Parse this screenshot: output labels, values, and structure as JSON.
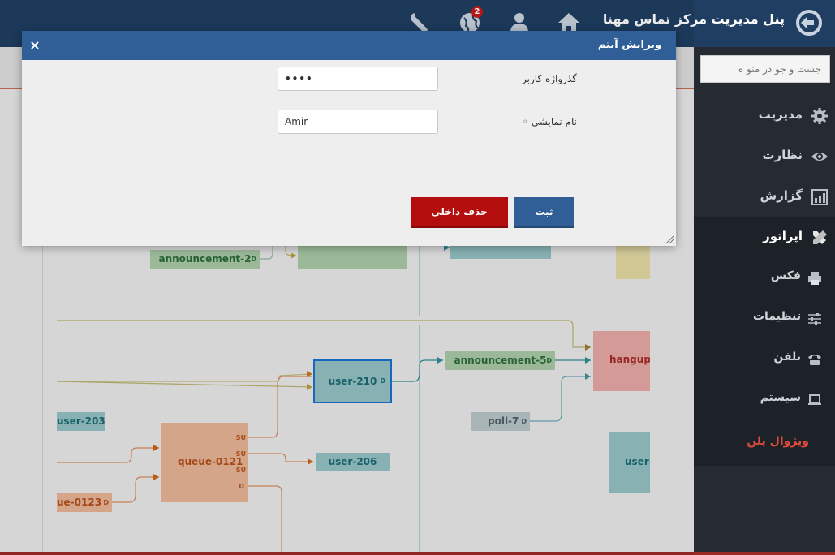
{
  "header": {
    "app_title": "پنل مدیریت مرکز تماس مهنا",
    "notification_count": "2"
  },
  "sidebar": {
    "search_placeholder": "جست و جو در منو ه",
    "items": [
      {
        "label": "مدیریت",
        "icon": "gear-icon"
      },
      {
        "label": "نظارت",
        "icon": "eye-icon"
      },
      {
        "label": "گزارش",
        "icon": "chart-icon"
      },
      {
        "label": "اپراتور",
        "icon": "tools-icon"
      },
      {
        "label": "فکس",
        "icon": "printer-icon"
      },
      {
        "label": "تنظیمات",
        "icon": "sliders-icon"
      },
      {
        "label": "تلفن",
        "icon": "phone-icon"
      },
      {
        "label": "سیستم",
        "icon": "laptop-icon"
      },
      {
        "label": "ویژوال پلن"
      }
    ]
  },
  "modal": {
    "title": "ویرایش آیتم",
    "close_glyph": "×",
    "password_label": "گذرواژه کاربر",
    "password_value": "••••",
    "display_name_label": "نام نمایشی ◦",
    "display_name_value": "Amir",
    "submit_label": "ثبت",
    "delete_label": "حذف داخلی"
  },
  "diagram": {
    "nodes": [
      {
        "label": "announcement-2",
        "d": "D"
      },
      {
        "label": "user-210",
        "d": "D"
      },
      {
        "label": "announcement-5",
        "d": "D"
      },
      {
        "label": "hangup-l"
      },
      {
        "label": "poll-7",
        "d": "D"
      },
      {
        "label": "user-203"
      },
      {
        "label": "queue-0121",
        "ports": [
          "SU",
          "SU",
          "SU",
          "D"
        ]
      },
      {
        "label": "user-206"
      },
      {
        "label": "ue-0123",
        "d": "D"
      },
      {
        "label": "user-"
      }
    ]
  },
  "colors": {
    "header_bg": "#1f3e62",
    "sidebar_bg": "#262b33",
    "modal_header": "#2f5f96",
    "delete_button": "#b30d0d"
  }
}
